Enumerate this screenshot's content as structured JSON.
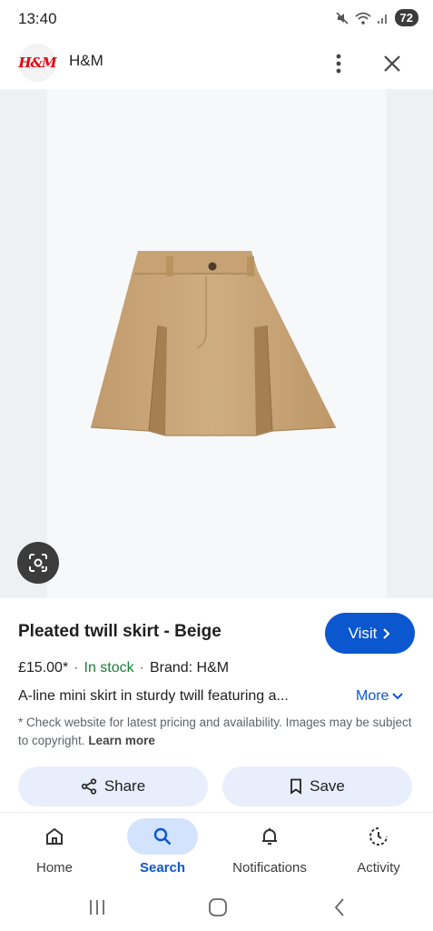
{
  "status_bar": {
    "time": "13:40",
    "battery": "72"
  },
  "header": {
    "site_name": "H&M",
    "logo_text": "H&M"
  },
  "product": {
    "title": "Pleated twill skirt - Beige",
    "price": "£15.00*",
    "stock": "In stock",
    "brand": "Brand: H&M",
    "description": "A-line mini skirt in sturdy twill featuring a...",
    "more_label": "More",
    "disclaimer": "* Check website for latest pricing and availability. Images may be subject to copyright.",
    "learn_more": "Learn more",
    "visit_label": "Visit",
    "image_color": "#c8a57a"
  },
  "actions": {
    "share_label": "Share",
    "save_label": "Save"
  },
  "bottom_nav": {
    "items": [
      {
        "label": "Home",
        "icon": "home-icon"
      },
      {
        "label": "Search",
        "icon": "search-icon",
        "active": true
      },
      {
        "label": "Notifications",
        "icon": "bell-icon"
      },
      {
        "label": "Activity",
        "icon": "activity-icon"
      }
    ]
  },
  "colors": {
    "accent": "#0b57d0",
    "stock": "#188038",
    "chip": "#e8eefc"
  }
}
